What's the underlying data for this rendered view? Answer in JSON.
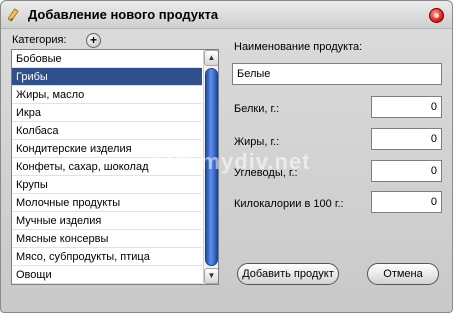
{
  "window": {
    "title": "Добавление нового продукта",
    "icon": "pencil-icon"
  },
  "category": {
    "label": "Категория:",
    "add_button": "+",
    "items": [
      "Бобовые",
      "Грибы",
      "Жиры, масло",
      "Икра",
      "Колбаса",
      "Кондитерские изделия",
      "Конфеты, сахар, шоколад",
      "Крупы",
      "Молочные продукты",
      "Мучные изделия",
      "Мясные консервы",
      "Мясо, субпродукты, птица",
      "Овощи"
    ],
    "selected_index": 1
  },
  "form": {
    "name_label": "Наименование продукта:",
    "name_value": "Белые",
    "protein_label": "Белки, г.:",
    "protein_value": "0",
    "fat_label": "Жиры, г.:",
    "fat_value": "0",
    "carbs_label": "Углеводы, г.:",
    "carbs_value": "0",
    "kcal_label": "Килокалории в 100 г.:",
    "kcal_value": "0"
  },
  "buttons": {
    "add": "Добавить продукт",
    "cancel": "Отмена"
  },
  "watermark": "soft.mydiv.net",
  "colors": {
    "selection": "#2f4f8f",
    "scroll_thumb": "#1d4fb0",
    "close": "#dd1111"
  }
}
